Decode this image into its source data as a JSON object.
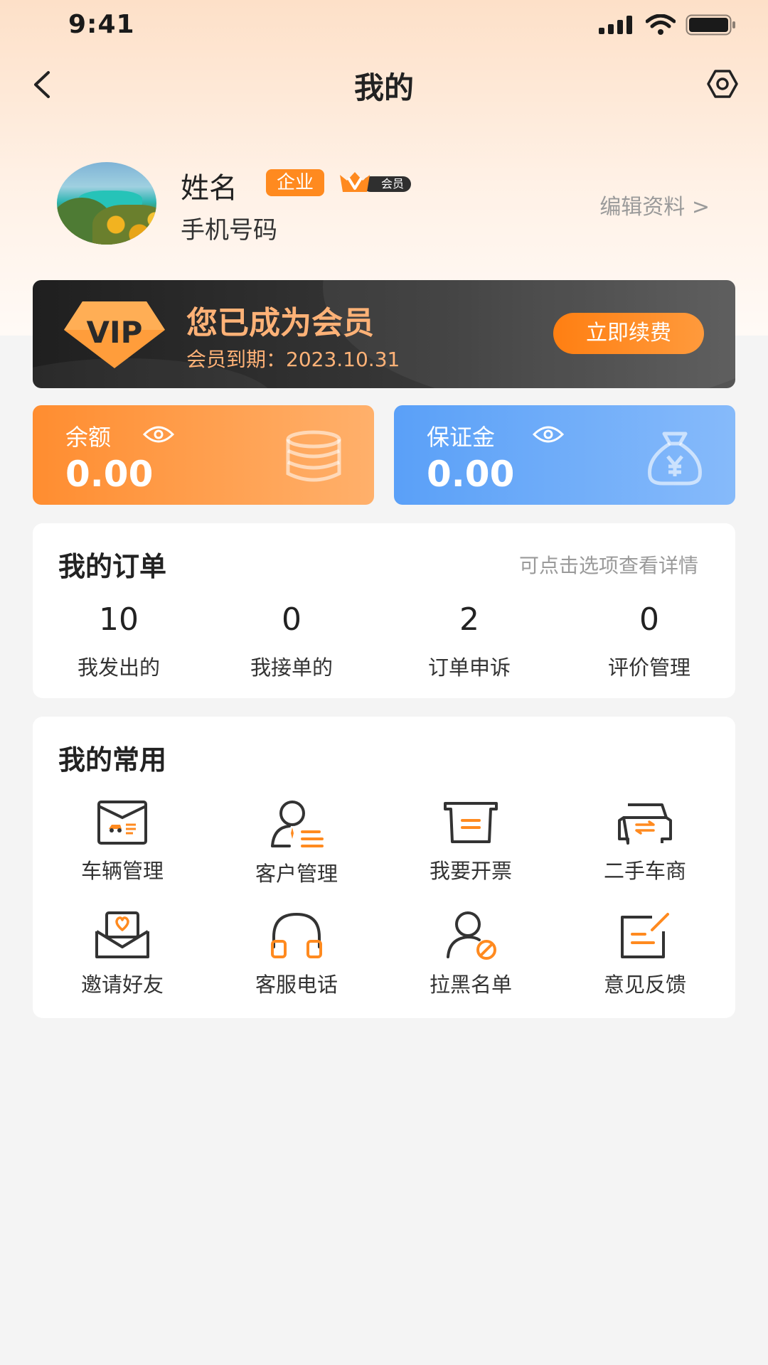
{
  "status_bar": {
    "time": "9:41"
  },
  "nav": {
    "title": "我的"
  },
  "profile": {
    "name": "姓名",
    "enterprise_badge": "企业",
    "member_badge": "会员",
    "phone": "手机号码",
    "edit_link": "编辑资料 >"
  },
  "vip": {
    "logo_text": "VIP",
    "title": "您已成为会员",
    "expiry": "会员到期：2023.10.31",
    "renew_button": "立即续费"
  },
  "balance": {
    "label": "余额",
    "value": "0.00"
  },
  "deposit": {
    "label": "保证金",
    "value": "0.00"
  },
  "orders": {
    "title": "我的订单",
    "hint": "可点击选项查看详情",
    "items": [
      {
        "count": "10",
        "label": "我发出的"
      },
      {
        "count": "0",
        "label": "我接单的"
      },
      {
        "count": "2",
        "label": "订单申诉"
      },
      {
        "count": "0",
        "label": "评价管理"
      }
    ]
  },
  "common": {
    "title": "我的常用",
    "items": [
      {
        "label": "车辆管理",
        "icon": "vehicle-management-icon"
      },
      {
        "label": "客户管理",
        "icon": "customer-management-icon"
      },
      {
        "label": "我要开票",
        "icon": "invoice-icon"
      },
      {
        "label": "二手车商",
        "icon": "used-car-dealer-icon"
      },
      {
        "label": "邀请好友",
        "icon": "invite-friends-icon"
      },
      {
        "label": "客服电话",
        "icon": "headset-icon"
      },
      {
        "label": "拉黑名单",
        "icon": "blacklist-icon"
      },
      {
        "label": "意见反馈",
        "icon": "feedback-icon"
      }
    ]
  },
  "colors": {
    "accent_orange": "#ff8a1f",
    "deposit_blue": "#5aa0f8",
    "vip_gold": "#ffb277",
    "page_bg": "#f4f4f4"
  }
}
